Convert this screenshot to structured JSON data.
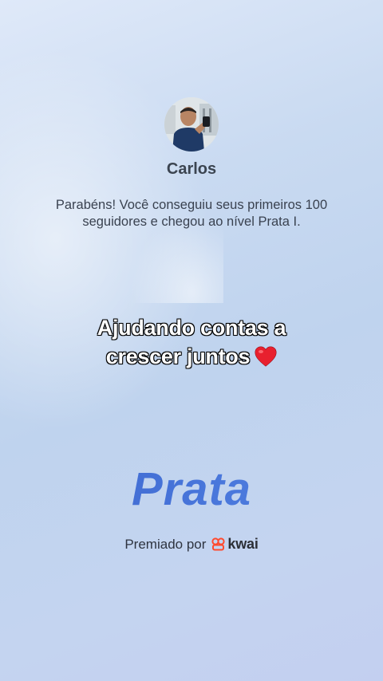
{
  "user": {
    "name": "Carlos"
  },
  "message": "Parabéns! Você conseguiu seus primeiros 100 seguidores e chegou ao nível Prata I.",
  "caption": {
    "line1": "Ajudando contas a",
    "line2": "crescer juntos",
    "emoji_icon": "red-heart-icon"
  },
  "tier": {
    "name": "Prata"
  },
  "award": {
    "label": "Premiado por",
    "brand": "kwai",
    "brand_icon": "kwai-logo-icon",
    "brand_color": "#ff4a2e"
  },
  "colors": {
    "tier_blue": "#3e6bd2",
    "background": "#c6d7f0"
  }
}
